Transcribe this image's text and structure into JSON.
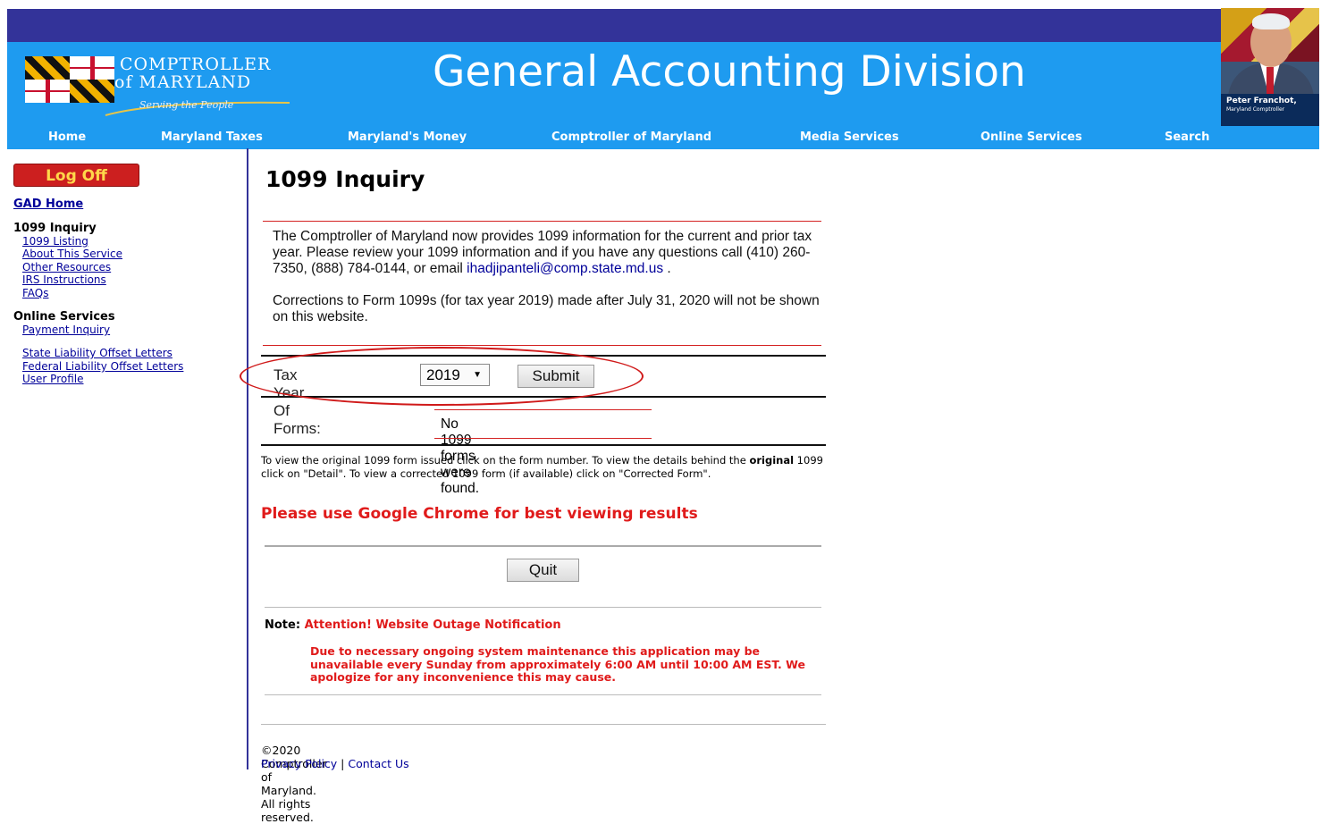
{
  "header": {
    "logo_line1": "COMPTROLLER",
    "logo_line2": "of MARYLAND",
    "logo_tagline": "Serving the People",
    "site_title": "General Accounting Division",
    "portrait_name": "Peter Franchot,",
    "portrait_role": "Maryland Comptroller"
  },
  "nav": [
    "Home",
    "Maryland Taxes",
    "Maryland's Money",
    "Comptroller of Maryland",
    "Media Services",
    "Online Services",
    "Search"
  ],
  "sidebar": {
    "logoff": "Log Off",
    "gad_home": "GAD Home",
    "section1_title": "1099 Inquiry",
    "section1_links": [
      "1099 Listing",
      "About This Service",
      "Other Resources",
      "IRS Instructions",
      "FAQs"
    ],
    "section2_title": "Online Services",
    "section2_links": [
      "Payment Inquiry"
    ],
    "extra_links": [
      "State Liability Offset Letters",
      "Federal Liability Offset Letters",
      "User Profile"
    ]
  },
  "main": {
    "title": "1099 Inquiry",
    "info_p1": "The Comptroller of Maryland now provides 1099 information for the current and prior tax year. Please review your 1099 information and if you have any questions call (410) 260-7350, (888) 784-0144, or email",
    "info_email": "ihadjipanteli@comp.state.md.us",
    "info_p2": "Corrections to Form 1099s (for tax year 2019) made after July 31, 2020 will not be shown on this website.",
    "form_label": "Tax Year Of Forms:",
    "tax_year": "2019",
    "submit": "Submit",
    "not_found": "No 1099 forms were found.",
    "help_a": "To view the original 1099 form issued click on the form number. To view the details behind the ",
    "help_bold": "original",
    "help_b": " 1099 click on \"Detail\". To view a corrected 1099 form (if available) click on \"Corrected Form\".",
    "chrome_note": "Please use Google Chrome for best viewing results",
    "quit": "Quit",
    "note_label": "Note:",
    "note_title": "Attention! Website Outage Notification",
    "outage_text": "Due to necessary ongoing system maintenance this application may be unavailable every Sunday from approximately 6:00 AM until 10:00 AM EST. We apologize for any inconvenience this may cause.",
    "copyright": "©2020 Comptroller of Maryland. All rights reserved.",
    "privacy": "Privacy Policy",
    "separator": "|",
    "contact": "Contact Us"
  },
  "colors": {
    "header_blue": "#1e9bf0",
    "top_bar": "#333399",
    "accent_red": "#e01b1b",
    "link": "#000099"
  }
}
